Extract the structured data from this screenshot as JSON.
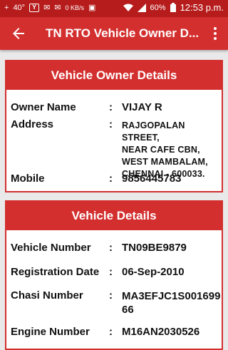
{
  "status_bar": {
    "left_indicators": [
      "+",
      "40°",
      "Y",
      "✉",
      "✉",
      "0 KB/s",
      "▣"
    ],
    "battery": "60%",
    "time": "12:53 p.m."
  },
  "app_bar": {
    "title": "TN RTO Vehicle Owner D..."
  },
  "owner_card": {
    "header": "Vehicle Owner Details",
    "owner_name_label": "Owner Name",
    "owner_name": "VIJAY R",
    "address_label": "Address",
    "address_lines": [
      "RAJGOPALAN STREET,",
      "NEAR CAFE CBN,",
      "WEST MAMBALAM,",
      "CHENNAI - 600033."
    ],
    "mobile_label": "Mobile",
    "mobile": "9856445783"
  },
  "vehicle_card": {
    "header": "Vehicle Details",
    "vehicle_number_label": "Vehicle Number",
    "vehicle_number": "TN09BE9879",
    "registration_date_label": "Registration Date",
    "registration_date": "06-Sep-2010",
    "chasi_number_label": "Chasi Number",
    "chasi_number_lines": [
      "MA3EFJC1S001699",
      "66"
    ],
    "engine_number_label": "Engine Number",
    "engine_number": "M16AN2030526"
  },
  "separator": ":"
}
